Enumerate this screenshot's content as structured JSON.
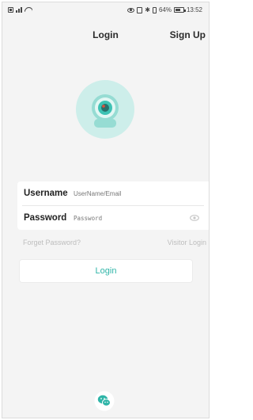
{
  "status_bar": {
    "battery_percent": "64%",
    "battery_level": 0.64,
    "time": "13:52",
    "icons": [
      "sim-icon",
      "signal-icon",
      "wifi-icon",
      "eye-icon",
      "nfc-icon",
      "bluetooth-icon",
      "vibrate-icon",
      "battery-icon"
    ]
  },
  "header": {
    "title": "Login",
    "signup_label": "Sign Up"
  },
  "logo": {
    "icon": "camera-icon",
    "colors": {
      "outer": "#cdeeea",
      "body": "#96dcd3",
      "lens_ring": "#3ec2b4",
      "lens_core": "#2a6f6b"
    }
  },
  "form": {
    "username_label": "Username",
    "username_placeholder": "UserName/Email",
    "username_value": "",
    "password_label": "Password",
    "password_placeholder": "Password",
    "password_value": "",
    "password_toggle_icon": "eye-icon"
  },
  "links": {
    "forget_password": "Forget Password?",
    "visitor_login": "Visitor Login"
  },
  "login_button": {
    "label": "Login"
  },
  "wechat": {
    "icon": "wechat-icon",
    "color": "#2fb5a8"
  },
  "colors": {
    "accent": "#2fb5a8",
    "background": "#f4f4f4",
    "muted_text": "#bdbdbd"
  }
}
